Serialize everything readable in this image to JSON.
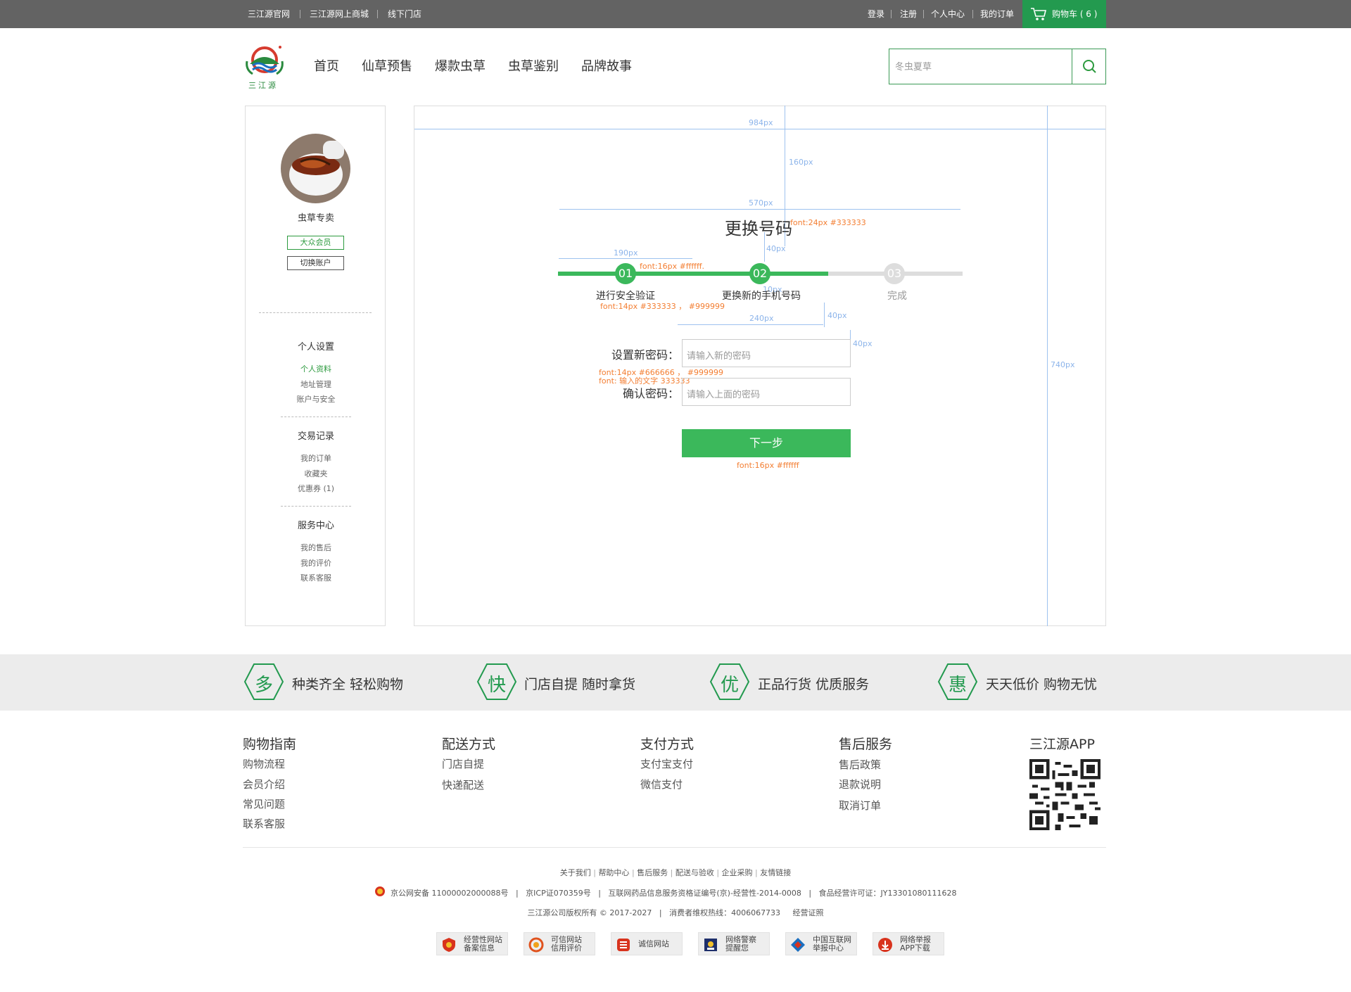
{
  "topbar": {
    "left_links": [
      "三江源官网",
      "三江源网上商城",
      "线下门店"
    ],
    "right_links": [
      "登录",
      "注册",
      "个人中心",
      "我的订单"
    ],
    "cart_label": "购物车 ( 6 )"
  },
  "header": {
    "logo_text": "三江源",
    "nav": [
      "首页",
      "仙草预售",
      "爆款虫草",
      "虫草鉴别",
      "品牌故事"
    ],
    "search_placeholder": "冬虫夏草"
  },
  "sidebar": {
    "username": "虫草专卖",
    "member_badge": "大众会员",
    "switch_account": "切换账户",
    "sections": [
      {
        "title": "个人设置",
        "items": [
          "个人资料",
          "地址管理",
          "账户与安全"
        ]
      },
      {
        "title": "交易记录",
        "items": [
          "我的订单",
          "收藏夹",
          "优惠券 (1)"
        ]
      },
      {
        "title": "服务中心",
        "items": [
          "我的售后",
          "我的评价",
          "联系客服"
        ]
      }
    ]
  },
  "main": {
    "title": "更换号码",
    "steps": [
      {
        "num": "01",
        "label": "进行安全验证",
        "state": "done"
      },
      {
        "num": "02",
        "label": "更换新的手机号码",
        "state": "current"
      },
      {
        "num": "03",
        "label": "完成",
        "state": "todo"
      }
    ],
    "fields": [
      {
        "label": "设置新密码：",
        "placeholder": "请输入新的密码"
      },
      {
        "label": "确认密码：",
        "placeholder": "请输入上面的密码"
      }
    ],
    "next_button": "下一步"
  },
  "annotations": {
    "w984": "984px",
    "h160": "160px",
    "w570": "570px",
    "title_font": "font:24px   #333333",
    "h40a": "40px",
    "w190": "190px",
    "circle_font": "font:16px   #ffffff.",
    "h10": "10px",
    "step_font": "font:14px   #333333 ，  #999999",
    "w240": "240px",
    "h40b": "40px",
    "h40c": "40px",
    "label_font": "font:14px   #666666 ，  #999999",
    "input_font": "font: 输入的文字 333333",
    "h740": "740px",
    "btn_font": "font:16px   #ffffff"
  },
  "benefits": [
    {
      "char": "多",
      "text": "种类齐全 轻松购物"
    },
    {
      "char": "快",
      "text": "门店自提   随时拿货"
    },
    {
      "char": "优",
      "text": "正品行货   优质服务"
    },
    {
      "char": "惠",
      "text": "天天低价   购物无忧"
    }
  ],
  "footer": {
    "columns": [
      {
        "title": "购物指南",
        "items": [
          "购物流程",
          "会员介绍",
          "常见问题",
          "联系客服"
        ]
      },
      {
        "title": "配送方式",
        "items": [
          "门店自提",
          "快递配送"
        ]
      },
      {
        "title": "支付方式",
        "items": [
          "支付宝支付",
          "微信支付"
        ]
      },
      {
        "title": "售后服务",
        "items": [
          "售后政策",
          "退款说明",
          "取消订单"
        ]
      }
    ],
    "app_title": "三江源APP",
    "links": [
      "关于我们",
      "帮助中心",
      "售后服务",
      "配送与验收",
      "企业采购",
      "友情链接"
    ],
    "license_line": "京公网安备 11000002000088号   |   京ICP证070359号   |   互联网药品信息服务资格证编号(京)-经营性-2014-0008   |   食品经营许可证：JY13301080111628",
    "copyright_line": "三江源公司版权所有 © 2017-2027   |   消费者维权热线：4006067733     经营证照",
    "badges": [
      {
        "line1": "经营性网站",
        "line2": "备案信息"
      },
      {
        "line1": "可信网站",
        "line2": "信用评价"
      },
      {
        "line1": "诚信网站",
        "line2": ""
      },
      {
        "line1": "网络警察",
        "line2": "提醒您"
      },
      {
        "line1": "中国互联网",
        "line2": "举报中心"
      },
      {
        "line1": "网络举报",
        "line2": "APP下载"
      }
    ]
  },
  "colors": {
    "green": "#239a4f",
    "button_green": "#3bb85b",
    "progress_gray": "#dddddd",
    "annotation": "#f37e32",
    "measure": "#8cb4ea"
  }
}
